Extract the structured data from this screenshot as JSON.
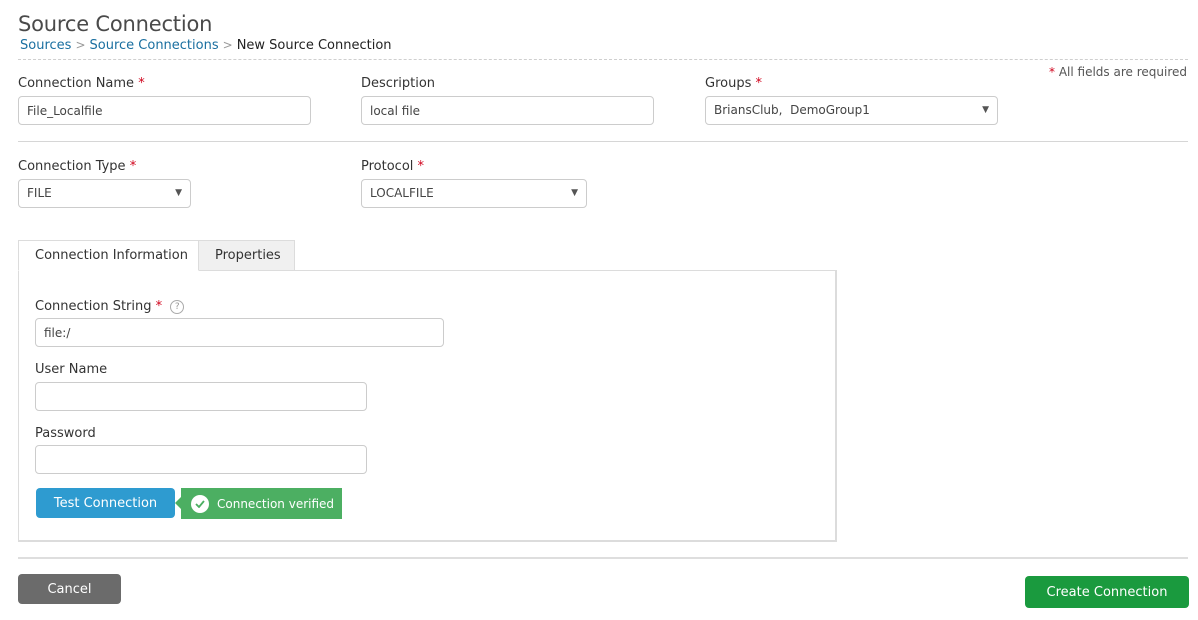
{
  "header": {
    "title": "Source Connection",
    "breadcrumb": [
      {
        "label": "Sources",
        "link": true
      },
      {
        "label": "Source Connections",
        "link": true
      },
      {
        "label": "New Source Connection",
        "link": false
      }
    ],
    "separator": ">",
    "required_note": "All fields are required",
    "required_marker": "*"
  },
  "form": {
    "connection_name": {
      "label": "Connection Name",
      "value": "File_Localfile",
      "required": true
    },
    "description": {
      "label": "Description",
      "value": "local file",
      "required": false
    },
    "groups": {
      "label": "Groups",
      "value": "BriansClub,  DemoGroup1",
      "required": true
    },
    "connection_type": {
      "label": "Connection Type",
      "value": "FILE",
      "required": true
    },
    "protocol": {
      "label": "Protocol",
      "value": "LOCALFILE",
      "required": true
    }
  },
  "tabs": [
    {
      "label": "Connection Information",
      "active": true
    },
    {
      "label": "Properties",
      "active": false
    }
  ],
  "connection_info": {
    "connection_string": {
      "label": "Connection String",
      "value": "file:/",
      "required": true,
      "help_icon": "?"
    },
    "user_name": {
      "label": "User Name",
      "value": ""
    },
    "password": {
      "label": "Password",
      "value": ""
    },
    "test_button": "Test Connection",
    "status": {
      "text": "Connection verified",
      "state": "success",
      "color": "#4caf62"
    }
  },
  "footer": {
    "cancel": "Cancel",
    "create": "Create Connection"
  },
  "colors": {
    "link": "#1a6fa0",
    "required": "#d0021b",
    "test_button": "#2e9bd0",
    "cancel_button": "#6b6b6b",
    "create_button": "#1a9a3e"
  }
}
